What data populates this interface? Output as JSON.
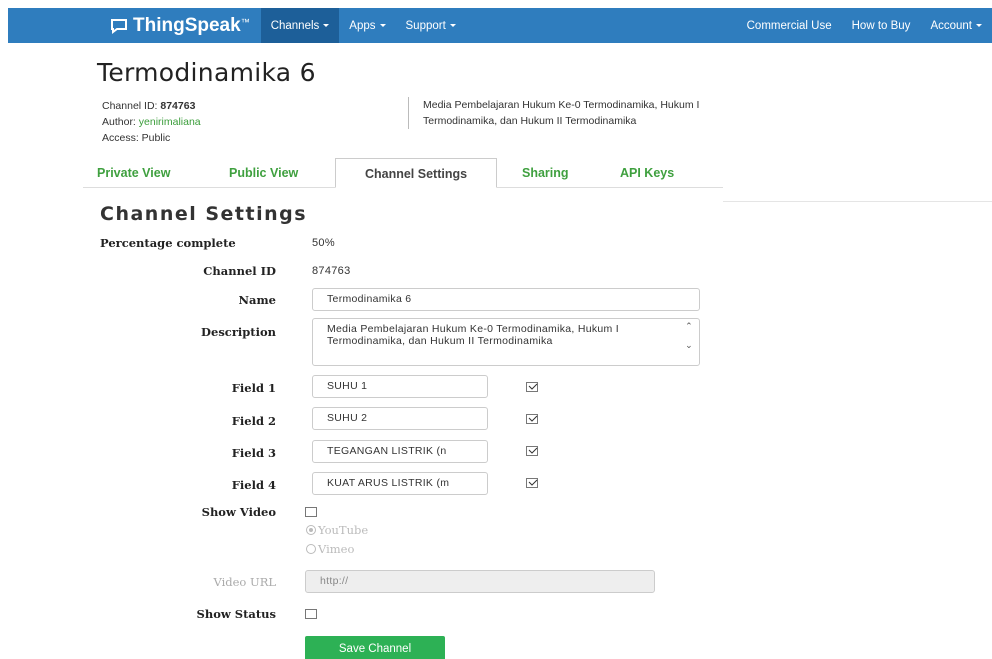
{
  "nav": {
    "brand": "ThingSpeak",
    "brand_tm": "™",
    "left_items": [
      "Channels",
      "Apps",
      "Support"
    ],
    "right_items": [
      "Commercial Use",
      "How to Buy",
      "Account"
    ]
  },
  "channel": {
    "title": "Termodinamika 6",
    "id_label": "Channel ID:",
    "id_value": "874763",
    "author_label": "Author:",
    "author_value": "yenirimaliana",
    "access": "Access: Public",
    "description": "Media Pembelajaran Hukum Ke-0 Termodinamika, Hukum I Termodinamika, dan Hukum II Termodinamika"
  },
  "tabs": [
    "Private View",
    "Public View",
    "Channel Settings",
    "Sharing",
    "API Keys"
  ],
  "settings": {
    "title": "Channel Settings",
    "percentage_label": "Percentage complete",
    "percentage_value": "50%",
    "channel_id_label": "Channel ID",
    "channel_id_value": "874763",
    "name_label": "Name",
    "name_value": "Termodinamika 6",
    "description_label": "Description",
    "description_value": "Media Pembelajaran Hukum Ke-0 Termodinamika, Hukum I Termodinamika, dan Hukum II Termodinamika",
    "fields": [
      {
        "label": "Field 1",
        "value": "SUHU  1",
        "checked": true
      },
      {
        "label": "Field 2",
        "value": "SUHU 2",
        "checked": true
      },
      {
        "label": "Field 3",
        "value": "TEGANGAN  LISTRIK (n",
        "checked": true
      },
      {
        "label": "Field 4",
        "value": "KUAT ARUS LISTRIK (m",
        "checked": true
      }
    ],
    "show_video_label": "Show Video",
    "video_options": [
      "YouTube",
      "Vimeo"
    ],
    "video_url_label": "Video URL",
    "video_url_placeholder": "http://",
    "show_status_label": "Show Status",
    "save_label": "Save Channel"
  }
}
